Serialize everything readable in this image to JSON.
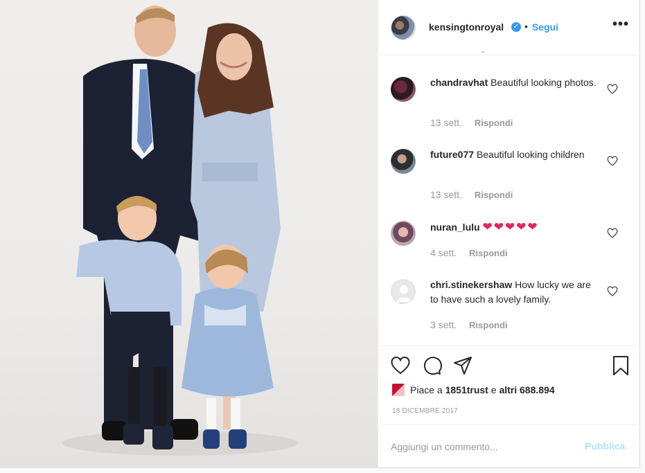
{
  "header": {
    "username": "kensingtonroyal",
    "separator": "•",
    "follow_label": "Segui",
    "more_label": "•••",
    "verified_mark": "✓",
    "cut_text": "p"
  },
  "comments": [
    {
      "user": "chandravhat",
      "text": "Beautiful looking photos.",
      "time": "13 sett.",
      "reply": "Rispondi"
    },
    {
      "user": "future077",
      "text": "Beautiful looking children",
      "time": "13 sett.",
      "reply": "Rispondi"
    },
    {
      "user": "nuran_lulu",
      "text": "❤❤❤❤❤",
      "time": "4 sett.",
      "reply": "Rispondi"
    },
    {
      "user": "chri.stinekershaw",
      "text": "How lucky we are to have such a lovely family.",
      "time": "3 sett.",
      "reply": "Rispondi"
    }
  ],
  "likes": {
    "prefix": "Piace a",
    "user": "1851trust",
    "middle": "e",
    "others": "altri 688.894"
  },
  "date": "18 DICEMBRE 2017",
  "add_comment": {
    "placeholder": "Aggiungi un commento...",
    "publish_label": "Pubblica"
  },
  "colors": {
    "accent": "#3897f0",
    "publish_disabled": "#b2dffc",
    "heart_red": "#e0245e",
    "muted": "#999999"
  },
  "icons": [
    "heart-icon",
    "comment-icon",
    "share-icon",
    "bookmark-icon",
    "verified-icon",
    "more-icon"
  ]
}
